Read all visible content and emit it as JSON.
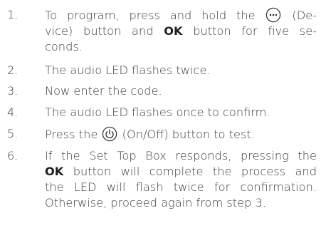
{
  "steps": [
    {
      "number": "1.",
      "part1": "To program, press and hold the",
      "icon": "device-button-icon",
      "part2": "(De-",
      "line2a": "vice) button and",
      "bold": "OK",
      "line2b": "button for five se-",
      "line3": "conds."
    },
    {
      "number": "2.",
      "text": "The audio LED flashes twice."
    },
    {
      "number": "3.",
      "text": "Now enter the code."
    },
    {
      "number": "4.",
      "text": "The audio LED flashes once to confirm."
    },
    {
      "number": "5.",
      "part1": "Press the",
      "icon": "power-button-icon",
      "part2": "(On/Off) button to test."
    },
    {
      "number": "6.",
      "line1": "If the Set Top Box responds, pressing the",
      "bold": "OK",
      "line2": "button will complete the process and",
      "line3": "the LED will flash twice for confirmation.",
      "line4": "Otherwise, proceed again from step 3."
    }
  ]
}
